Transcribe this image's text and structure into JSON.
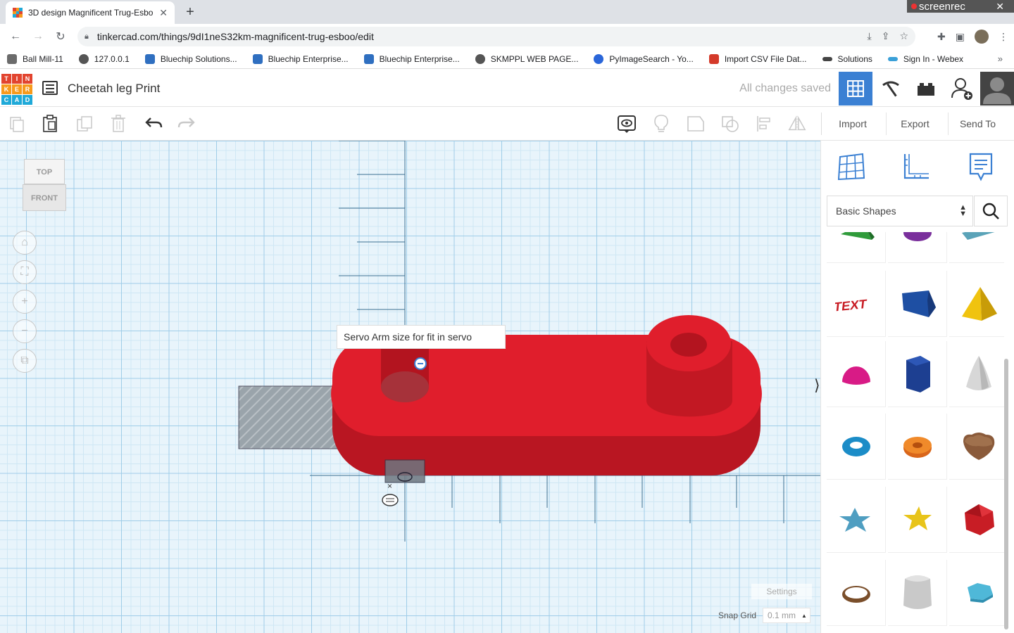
{
  "browser": {
    "tab_title": "3D design Magnificent Trug-Esbo",
    "tab_close": "✕",
    "new_tab": "+",
    "url": "tinkercad.com/things/9dI1neS32km-magnificent-trug-esboo/edit",
    "screenrec_label": "screenrec",
    "bookmarks": [
      {
        "label": "Ball Mill-11",
        "color": "#6b6b6b"
      },
      {
        "label": "127.0.0.1",
        "color": "#555555"
      },
      {
        "label": "Bluechip Solutions...",
        "color": "#2f6fc0"
      },
      {
        "label": "Bluechip Enterprise...",
        "color": "#2f6fc0"
      },
      {
        "label": "Bluechip Enterprise...",
        "color": "#2f6fc0"
      },
      {
        "label": "SKMPPL WEB PAGE...",
        "color": "#555555"
      },
      {
        "label": "PyImageSearch - Yo...",
        "color": "#2a66d9"
      },
      {
        "label": "Import CSV File Dat...",
        "color": "#d43a2a"
      },
      {
        "label": "Solutions",
        "color": "#444444"
      },
      {
        "label": "Sign In - Webex",
        "color": "#3aa0d8"
      }
    ],
    "bookmarks_more": "»"
  },
  "app": {
    "logo_letters": [
      "T",
      "I",
      "N",
      "K",
      "E",
      "R",
      "C",
      "A",
      "D"
    ],
    "logo_colors": [
      "#e2442f",
      "#e2442f",
      "#e2442f",
      "#f79a1c",
      "#f79a1c",
      "#f79a1c",
      "#1fa9d8",
      "#1fa9d8",
      "#1fa9d8"
    ],
    "design_title": "Cheetah leg Print",
    "save_status": "All changes saved",
    "accent": "#3b80d3"
  },
  "toolbar": {
    "import_label": "Import",
    "export_label": "Export",
    "send_to_label": "Send To"
  },
  "workplane": {
    "viewcube_top": "TOP",
    "viewcube_front": "FRONT",
    "tooltip": "Servo Arm size for fit in servo",
    "settings_label": "Settings",
    "snap_grid_label": "Snap Grid",
    "snap_grid_value": "0.1 mm",
    "shape_color": "#e01e2c"
  },
  "panel": {
    "library_selected": "Basic Shapes",
    "shapes": [
      "wedge-shape",
      "paraboloid-shape",
      "roof-shape",
      "text-shape",
      "box-shape",
      "pyramid-shape",
      "half-sphere-shape",
      "polygon-shape",
      "cone-shape",
      "torus-shape",
      "tube-shape",
      "heart-shape",
      "star-shape-blue",
      "star-shape-yellow",
      "icosahedron-shape",
      "ring-shape",
      "round-roof-shape",
      "hexagon-shape"
    ]
  }
}
